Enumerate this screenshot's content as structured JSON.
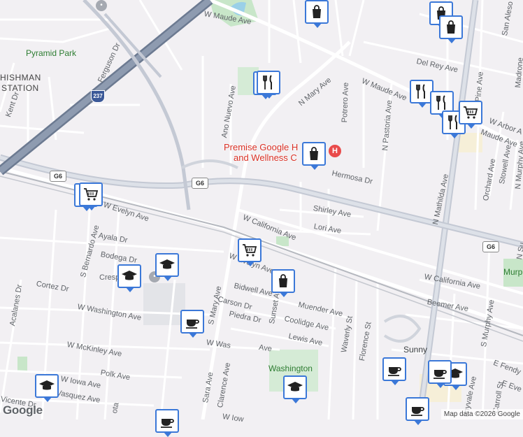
{
  "map": {
    "streets": [
      "W Maude Ave",
      "W Maude Ave",
      "Maude Ave",
      "Pyramid Park",
      "HISHMAN",
      "STATION",
      "Ferguson Dr",
      "Kent Dr",
      "Ano Nuevo Ave",
      "N Mary Ave",
      "Potrero Ave",
      "N Pastoria Ave",
      "Del Rey Ave",
      "Pine Ave",
      "San Aleso",
      "Madrone",
      "W Arbor A",
      "Hermosa Dr",
      "Shirley Ave",
      "Lori Ave",
      "W California Ave",
      "W California Ave",
      "N Mathilda Ave",
      "Orchard Ave",
      "Stowell Ave",
      "N Murphy Ave",
      "W Evelyn Ave",
      "W Evelyn Ave",
      "S Bernardo Ave",
      "Ayala Dr",
      "Bodega Dr",
      "Crespi",
      "Cortez Dr",
      "Acalanes Dr",
      "W Washington Ave",
      "S Mary Ave",
      "Carson Dr",
      "Bidwell Ave",
      "Sunset Ave",
      "Muender Ave",
      "Coolidge Ave",
      "Lewis Ave",
      "Piedra Dr",
      "W Was",
      "Ave",
      "W McKinley Ave",
      "Polk Ave",
      "W Iowa Ave",
      "Vasquez Ave",
      "Vicente Dr",
      "Sara Ave",
      "Clarence Ave",
      "W Iow",
      "Waverly St",
      "Florence St",
      "Beemer Ave",
      "S Murphy Ave",
      "Sunny",
      "E Fendy",
      "E Eve",
      "Carroll St",
      "nnyvale Ave",
      "Murp",
      "N Su",
      "Washington",
      "ota"
    ],
    "poi": {
      "hospital_name_line1": "Premise Google H",
      "hospital_name_line2": "and Wellness C",
      "hospital_icon": "H"
    },
    "shields": {
      "interstate": "237",
      "g6a": "G6",
      "g6b": "G6",
      "g6c": "G6"
    },
    "brand": "Google",
    "attribution": "Map data ©2026 Google"
  },
  "markers": [
    {
      "kind": "shopping-bag",
      "label": "Shopping"
    },
    {
      "kind": "shopping-bag",
      "label": "Shopping"
    },
    {
      "kind": "shopping-bag",
      "label": "Shopping"
    },
    {
      "kind": "shopping-bag",
      "label": "Shopping"
    },
    {
      "kind": "shopping-bag",
      "label": "Shopping"
    },
    {
      "kind": "restaurant",
      "label": "Restaurant"
    },
    {
      "kind": "restaurant",
      "label": "Restaurant"
    },
    {
      "kind": "restaurant",
      "label": "Restaurant"
    },
    {
      "kind": "restaurant",
      "label": "Restaurant"
    },
    {
      "kind": "restaurant",
      "label": "Restaurant"
    },
    {
      "kind": "restaurant",
      "label": "Restaurant"
    },
    {
      "kind": "cart",
      "label": "Grocery"
    },
    {
      "kind": "cart",
      "label": "Grocery"
    },
    {
      "kind": "cart",
      "label": "Grocery"
    },
    {
      "kind": "school",
      "label": "School"
    },
    {
      "kind": "school",
      "label": "School"
    },
    {
      "kind": "school",
      "label": "School"
    },
    {
      "kind": "school",
      "label": "School"
    },
    {
      "kind": "school",
      "label": "School"
    },
    {
      "kind": "cafe",
      "label": "Cafe"
    },
    {
      "kind": "cafe",
      "label": "Cafe"
    },
    {
      "kind": "cafe",
      "label": "Cafe"
    },
    {
      "kind": "cafe",
      "label": "Cafe"
    },
    {
      "kind": "cafe",
      "label": "Cafe"
    }
  ],
  "colors": {
    "land": "#f2f0f3",
    "park": "#c8e6c9",
    "road": "#ffffff",
    "highway": "#8e9bb0",
    "highway_edge": "#6c7a91",
    "rail": "#b5b8bf",
    "marker_border": "#3b78d8",
    "hospital": "#e94b4b"
  }
}
